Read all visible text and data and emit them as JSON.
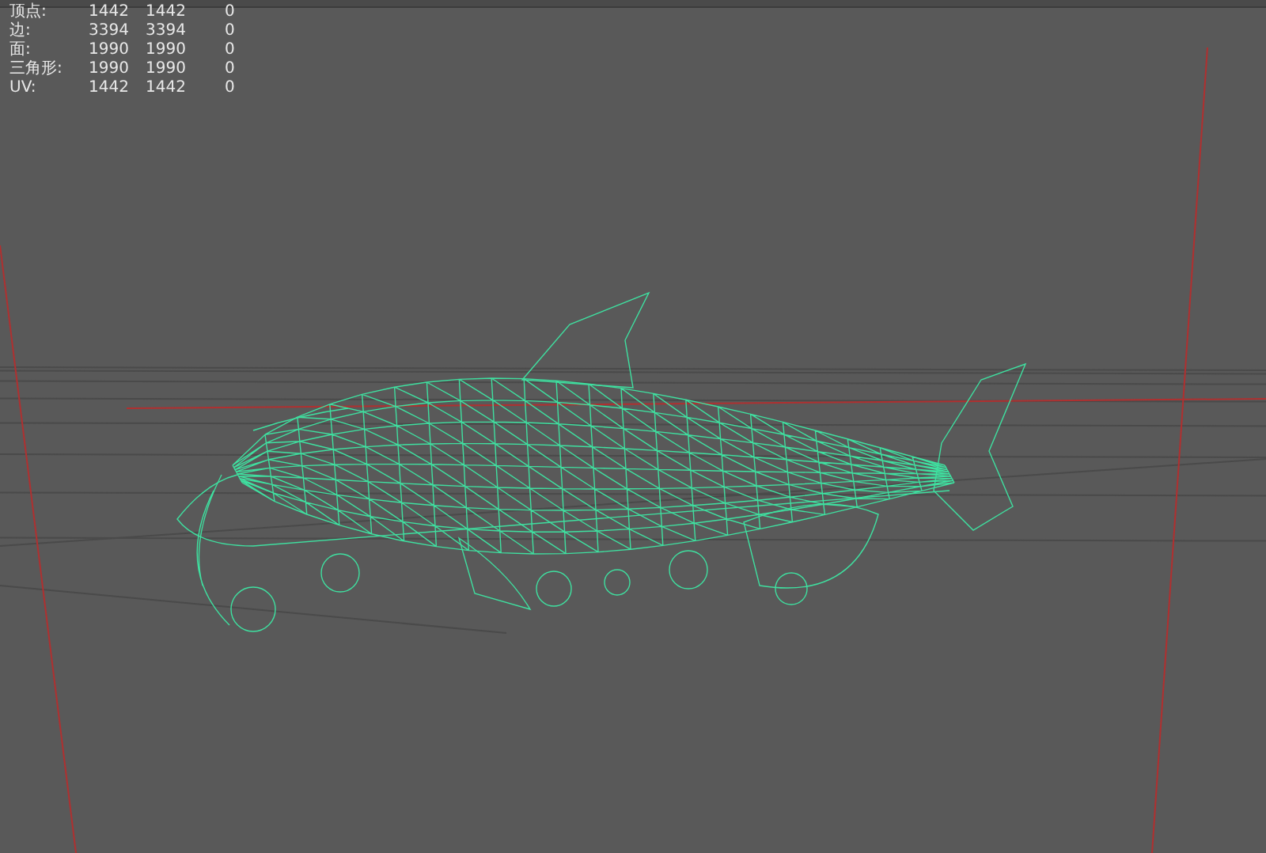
{
  "stats": [
    {
      "label": "顶点:",
      "values": [
        "1442",
        "1442",
        "0"
      ]
    },
    {
      "label": "边:",
      "values": [
        "3394",
        "3394",
        "0"
      ]
    },
    {
      "label": "面:",
      "values": [
        "1990",
        "1990",
        "0"
      ]
    },
    {
      "label": "三角形:",
      "values": [
        "1990",
        "1990",
        "0"
      ]
    },
    {
      "label": "UV:",
      "values": [
        "1442",
        "1442",
        "0"
      ]
    }
  ]
}
